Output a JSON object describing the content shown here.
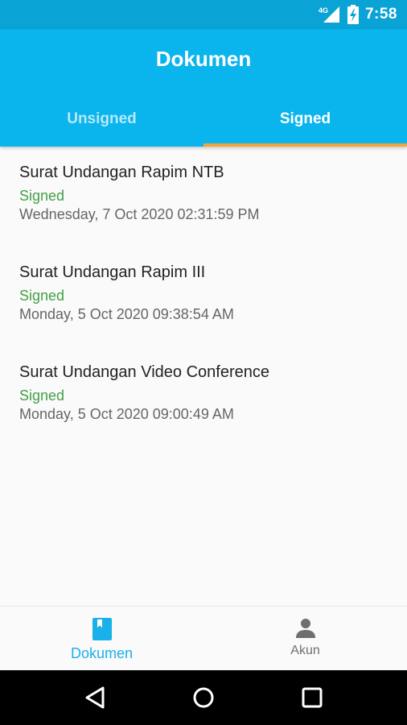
{
  "status_bar": {
    "network": "4G",
    "time": "7:58"
  },
  "app_bar": {
    "title": "Dokumen"
  },
  "tabs": [
    {
      "label": "Unsigned",
      "active": false
    },
    {
      "label": "Signed",
      "active": true
    }
  ],
  "documents": [
    {
      "title": "Surat Undangan Rapim NTB",
      "status": "Signed",
      "date": "Wednesday, 7 Oct 2020 02:31:59 PM"
    },
    {
      "title": "Surat Undangan Rapim III",
      "status": "Signed",
      "date": "Monday, 5 Oct 2020 09:38:54 AM"
    },
    {
      "title": "Surat Undangan Video Conference",
      "status": "Signed",
      "date": "Monday, 5 Oct 2020 09:00:49 AM"
    }
  ],
  "bottom_nav": [
    {
      "label": "Dokumen",
      "icon": "book-icon",
      "active": true
    },
    {
      "label": "Akun",
      "icon": "person-icon",
      "active": false
    }
  ],
  "colors": {
    "primary": "#0ab4ec",
    "status_bar": "#0aa3d6",
    "tab_indicator": "#f0a63a",
    "signed_status": "#43a047",
    "nav_active": "#1ab0ea",
    "nav_inactive": "#6f6f6f"
  }
}
